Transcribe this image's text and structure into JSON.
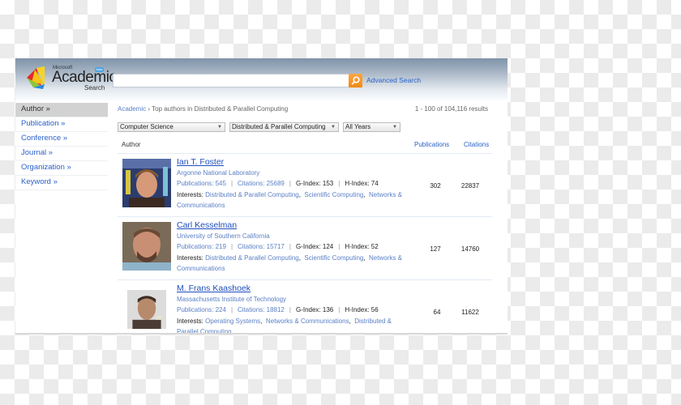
{
  "logo": {
    "brand": "Microsoft",
    "title": "Academic",
    "subtitle": "Search",
    "badge": "beta"
  },
  "search": {
    "placeholder": "",
    "value": "",
    "button_icon": "search-icon",
    "advanced_label": "Advanced Search"
  },
  "sidebar": {
    "items": [
      {
        "label": "Author »",
        "active": true
      },
      {
        "label": "Publication »"
      },
      {
        "label": "Conference »"
      },
      {
        "label": "Journal »"
      },
      {
        "label": "Organization »"
      },
      {
        "label": "Keyword »"
      }
    ]
  },
  "breadcrumb": {
    "root": "Academic",
    "separator": "›",
    "current": "Top authors in Distributed & Parallel Computing"
  },
  "results_summary": "1 - 100 of 104,116 results",
  "filters": {
    "field": "Computer Science",
    "subfield": "Distributed & Parallel Computing",
    "years": "All Years"
  },
  "columns": {
    "author": "Author",
    "publications": "Publications",
    "citations": "Citations"
  },
  "labels": {
    "publications": "Publications:",
    "citations": "Citations:",
    "gindex": "G-Index:",
    "hindex": "H-Index:",
    "interests": "Interests:",
    "separator": "|"
  },
  "authors": [
    {
      "name": "Ian T. Foster",
      "affiliation": "Argonne National Laboratory",
      "publications": "545",
      "citations": "25689",
      "gindex": "153",
      "hindex": "74",
      "interests": [
        "Distributed & Parallel Computing",
        "Scientific Computing",
        "Networks & Communications"
      ],
      "col_publications": "302",
      "col_citations": "22837"
    },
    {
      "name": "Carl Kesselman",
      "affiliation": "University of Southern California",
      "publications": "219",
      "citations": "15717",
      "gindex": "124",
      "hindex": "52",
      "interests": [
        "Distributed & Parallel Computing",
        "Scientific Computing",
        "Networks & Communications"
      ],
      "col_publications": "127",
      "col_citations": "14760"
    },
    {
      "name": "M. Frans Kaashoek",
      "affiliation": "Massachusetts Institute of Technology",
      "publications": "224",
      "citations": "18812",
      "gindex": "136",
      "hindex": "56",
      "interests": [
        "Operating Systems",
        "Networks & Communications",
        "Distributed & Parallel Computing"
      ],
      "col_publications": "64",
      "col_citations": "11622"
    }
  ],
  "colors": {
    "link": "#2a62c9",
    "search_button": "#f08a14",
    "header_top": "#7f93a9"
  }
}
